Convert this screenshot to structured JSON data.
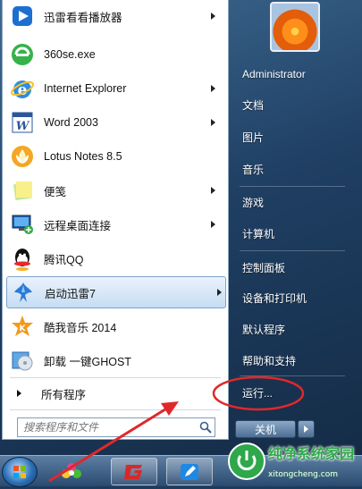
{
  "programs": [
    {
      "label": "迅雷看看播放器",
      "has_arrow": true,
      "icon": "xunlei-kankan-icon"
    },
    {
      "label": "360se.exe",
      "has_arrow": false,
      "icon": "360se-icon"
    },
    {
      "label": "Internet Explorer",
      "has_arrow": true,
      "icon": "internet-explorer-icon"
    },
    {
      "label": "Word 2003",
      "has_arrow": true,
      "icon": "word-icon"
    },
    {
      "label": "Lotus Notes 8.5",
      "has_arrow": false,
      "icon": "lotus-notes-icon"
    },
    {
      "label": "便笺",
      "has_arrow": true,
      "icon": "sticky-notes-icon"
    },
    {
      "label": "远程桌面连接",
      "has_arrow": true,
      "icon": "remote-desktop-icon"
    },
    {
      "label": "腾讯QQ",
      "has_arrow": false,
      "icon": "qq-icon"
    },
    {
      "label": "启动迅雷7",
      "has_arrow": true,
      "icon": "xunlei-icon",
      "selected": true
    },
    {
      "label": "酷我音乐 2014",
      "has_arrow": false,
      "icon": "kuwo-icon"
    },
    {
      "label": "卸载 一键GHOST",
      "has_arrow": false,
      "icon": "ghost-uninstall-icon"
    }
  ],
  "all_programs": "所有程序",
  "search": {
    "placeholder": "搜索程序和文件"
  },
  "right": {
    "user": "Administrator",
    "items": [
      "文档",
      "图片",
      "音乐",
      "游戏",
      "计算机",
      "控制面板",
      "设备和打印机",
      "默认程序",
      "帮助和支持",
      "运行..."
    ]
  },
  "shutdown": {
    "label": "关机"
  },
  "watermark": {
    "text": "纯净系统家园",
    "url": "xitongcheng.com"
  },
  "colors": {
    "annotation": "#e0282a",
    "accent": "#2b6fb5"
  }
}
